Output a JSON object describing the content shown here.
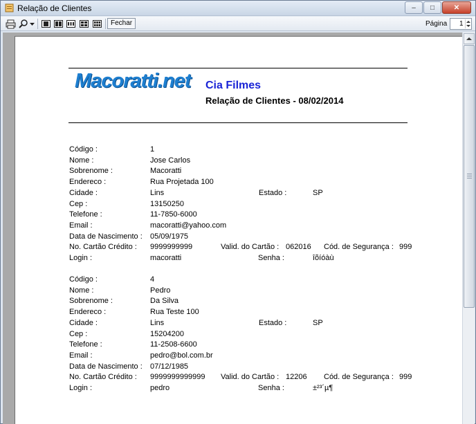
{
  "window": {
    "title": "Relação de Clientes",
    "buttons": [
      "–",
      "□",
      "✕"
    ]
  },
  "toolbar": {
    "print_icon": "printer-icon",
    "zoom_icon": "magnifier-icon",
    "close_label": "Fechar",
    "page_label": "Página",
    "page_value": "1"
  },
  "report": {
    "logo_text": "Macoratti.net",
    "company": "Cia Filmes",
    "title": "Relação de Clientes  - 08/02/2014"
  },
  "labels": {
    "codigo": "Código :",
    "nome": "Nome :",
    "sobrenome": "Sobrenome :",
    "endereco": "Endereco :",
    "cidade": "Cidade :",
    "estado": "Estado :",
    "cep": "Cep :",
    "telefone": "Telefone :",
    "email": "Email :",
    "nascimento": "Data de Nascimento :",
    "cartao": "No. Cartão Crédito :",
    "validade": "Valid. do Cartão :",
    "seguranca": "Cód. de Segurança  :",
    "login": "Login  :",
    "senha": "Senha  :"
  },
  "clients": [
    {
      "codigo": "1",
      "nome": "Jose Carlos",
      "sobrenome": "Macoratti",
      "endereco": "Rua Projetada 100",
      "cidade": "Lins",
      "estado": "SP",
      "cep": "13150250",
      "telefone": "11-7850-6000",
      "email": "macoratti@yahoo.com",
      "nascimento": "05/09/1975",
      "cartao": "9999999999",
      "validade": "062016",
      "seguranca": "999",
      "login": "macoratti",
      "senha": "îõíóàù"
    },
    {
      "codigo": "4",
      "nome": "Pedro",
      "sobrenome": "Da Silva",
      "endereco": "Rua Teste 100",
      "cidade": "Lins",
      "estado": "SP",
      "cep": "15204200",
      "telefone": "11-2508-6600",
      "email": "pedro@bol.com.br",
      "nascimento": "07/12/1985",
      "cartao": "9999999999999",
      "validade": "12206",
      "seguranca": "999",
      "login": "pedro",
      "senha": "±²³´µ¶"
    }
  ]
}
